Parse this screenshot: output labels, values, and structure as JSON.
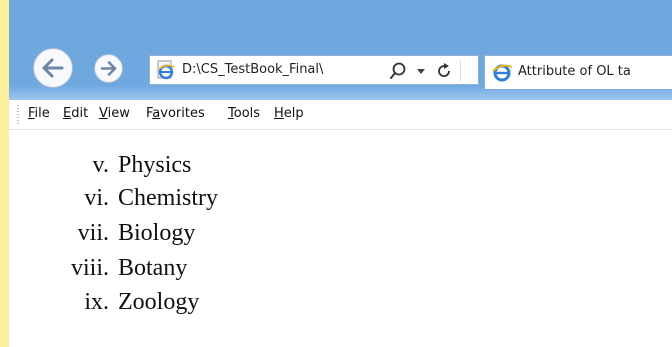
{
  "browser": {
    "address": "D:\\CS_TestBook_Final\\",
    "tab_title": "Attribute of OL ta"
  },
  "menu": {
    "items": [
      {
        "label": "File",
        "accel": "F"
      },
      {
        "label": "Edit",
        "accel": "E"
      },
      {
        "label": "View",
        "accel": "V"
      },
      {
        "label": "Favorites",
        "accel": "a"
      },
      {
        "label": "Tools",
        "accel": "T"
      },
      {
        "label": "Help",
        "accel": "H"
      }
    ]
  },
  "list": {
    "items": [
      {
        "marker": "v.",
        "label": "Physics"
      },
      {
        "marker": "vi.",
        "label": "Chemistry"
      },
      {
        "marker": "vii.",
        "label": "Biology"
      },
      {
        "marker": "viii.",
        "label": "Botany"
      },
      {
        "marker": "ix.",
        "label": "Zoology"
      }
    ]
  },
  "colors": {
    "frame_background": "#fbef9b",
    "title_bar": "#6fa7df",
    "ie_icon": "#2f7fd8"
  },
  "icons": [
    "back-arrow-icon",
    "forward-arrow-icon",
    "ie-page-icon",
    "search-icon",
    "dropdown-arrow-icon",
    "refresh-icon",
    "ie-tab-icon"
  ]
}
